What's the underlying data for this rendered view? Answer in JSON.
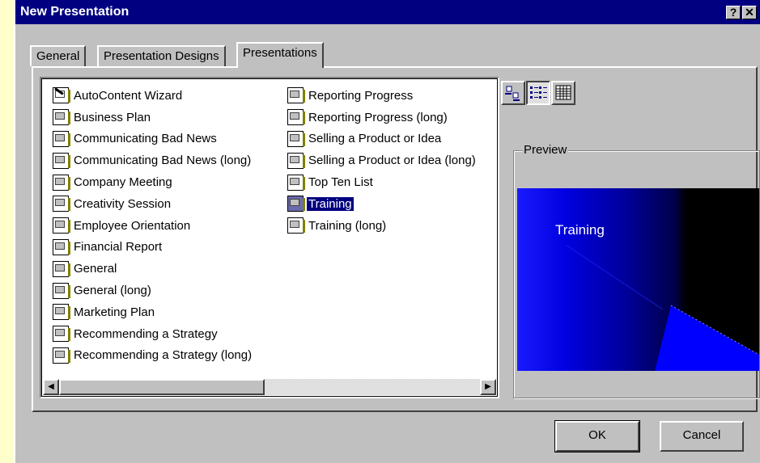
{
  "window": {
    "title": "New Presentation",
    "help_label": "?",
    "close_label": "✕"
  },
  "tabs": [
    {
      "label": "General",
      "active": false
    },
    {
      "label": "Presentation Designs",
      "active": false
    },
    {
      "label": "Presentations",
      "active": true
    }
  ],
  "presentations": {
    "column1": [
      "AutoContent Wizard",
      "Business Plan",
      "Communicating Bad News",
      "Communicating Bad News (long)",
      "Company Meeting",
      "Creativity Session",
      "Employee Orientation",
      "Financial Report",
      "General",
      "General (long)",
      "Marketing Plan",
      "Recommending a Strategy",
      "Recommending a Strategy (long)"
    ],
    "column2": [
      "Reporting Progress",
      "Reporting Progress (long)",
      "Selling a Product or Idea",
      "Selling a Product or Idea (long)",
      "Top Ten List",
      "Training",
      "Training (long)"
    ],
    "selected": "Training"
  },
  "view_buttons": [
    {
      "icon": "large-icons-icon",
      "pressed": false
    },
    {
      "icon": "list-view-icon",
      "pressed": true
    },
    {
      "icon": "details-view-icon",
      "pressed": false
    }
  ],
  "scrollbar": {
    "left_arrow": "◀",
    "right_arrow": "▶"
  },
  "preview": {
    "label": "Preview",
    "slide_title": "Training",
    "background_color": "#000000",
    "accent_color": "#0000ff"
  },
  "buttons": {
    "ok": "OK",
    "cancel": "Cancel"
  }
}
